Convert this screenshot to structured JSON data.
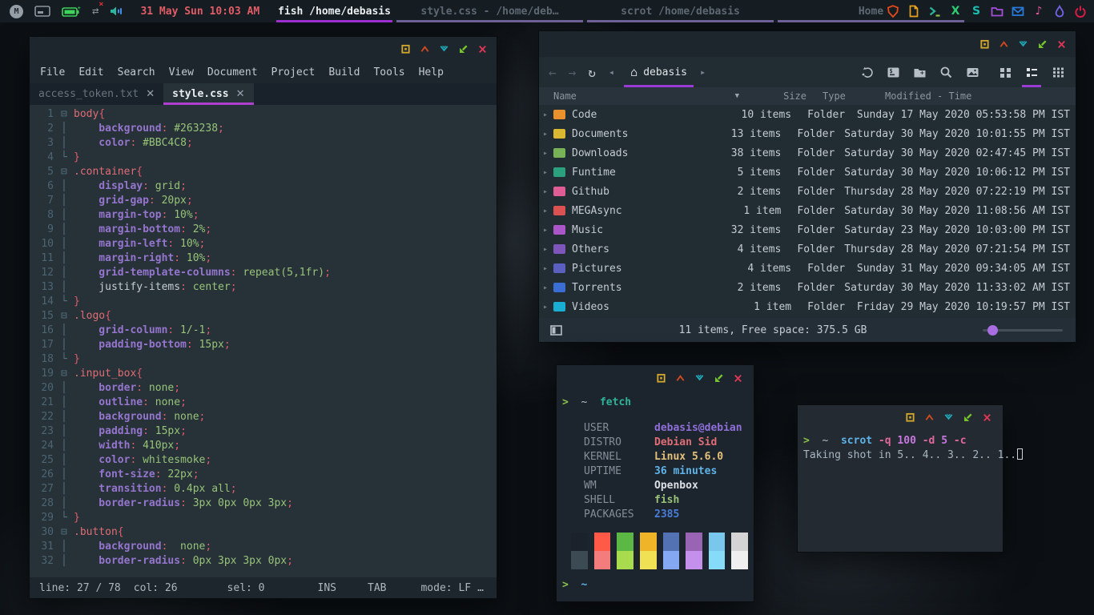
{
  "colors": {
    "accent_purple": "#9b2fd0",
    "tab_magenta": "#b03fd0",
    "clock_red": "#e05c66",
    "editor_bg": "#263238",
    "terminal_bg": "#1c252d"
  },
  "window_buttons": [
    "omni",
    "shade",
    "iconify",
    "maximize",
    "close"
  ],
  "panel": {
    "clock": "31 May Sun 10:03 AM",
    "status_icons": [
      "mega-icon",
      "pager-icon",
      "battery-charging-icon",
      "network-disconnected-icon",
      "volume-icon"
    ],
    "tasks": [
      {
        "label": "fish /home/debasis",
        "active": true
      },
      {
        "label": "style.css - /home/deb…",
        "active": false
      },
      {
        "label": "scrot /home/debasis",
        "active": false
      },
      {
        "label": "Home",
        "active": false
      }
    ],
    "tray_icons": [
      "shield-icon",
      "document-icon",
      "terminal-icon",
      "x-app-icon",
      "s-app-icon",
      "folder-icon",
      "mail-icon",
      "music-icon",
      "drop-icon",
      "power-icon"
    ]
  },
  "editor": {
    "menus": [
      "File",
      "Edit",
      "Search",
      "View",
      "Document",
      "Project",
      "Build",
      "Tools",
      "Help"
    ],
    "tabs": [
      {
        "label": "access_token.txt",
        "close": "✕",
        "active": false
      },
      {
        "label": "style.css",
        "close": "✕",
        "active": true
      }
    ],
    "code_lines": [
      {
        "n": "1",
        "f": "o",
        "s": [
          [
            "sel",
            "body"
          ],
          [
            "punc",
            "{"
          ]
        ]
      },
      {
        "n": "2",
        "f": "v",
        "s": [
          [
            "prop",
            "    background"
          ],
          [
            "punc",
            ":"
          ],
          [
            "val",
            " #263238"
          ],
          [
            "punc",
            ";"
          ]
        ]
      },
      {
        "n": "3",
        "f": "v",
        "s": [
          [
            "prop",
            "    color"
          ],
          [
            "punc",
            ":"
          ],
          [
            "val",
            " #BBC4C8"
          ],
          [
            "punc",
            ";"
          ]
        ]
      },
      {
        "n": "4",
        "f": "c",
        "s": [
          [
            "punc",
            "}"
          ]
        ]
      },
      {
        "n": "5",
        "f": "o",
        "s": [
          [
            "sel",
            ".container"
          ],
          [
            "punc",
            "{"
          ]
        ]
      },
      {
        "n": "6",
        "f": "v",
        "s": [
          [
            "prop",
            "    display"
          ],
          [
            "punc",
            ":"
          ],
          [
            "val",
            " grid"
          ],
          [
            "punc",
            ";"
          ]
        ]
      },
      {
        "n": "7",
        "f": "v",
        "s": [
          [
            "prop",
            "    grid-gap"
          ],
          [
            "punc",
            ":"
          ],
          [
            "val",
            " 20px"
          ],
          [
            "punc",
            ";"
          ]
        ]
      },
      {
        "n": "8",
        "f": "v",
        "s": [
          [
            "prop",
            "    margin-top"
          ],
          [
            "punc",
            ":"
          ],
          [
            "val",
            " 10%"
          ],
          [
            "punc",
            ";"
          ]
        ]
      },
      {
        "n": "9",
        "f": "v",
        "s": [
          [
            "prop",
            "    margin-bottom"
          ],
          [
            "punc",
            ":"
          ],
          [
            "val",
            " 2%"
          ],
          [
            "punc",
            ";"
          ]
        ]
      },
      {
        "n": "10",
        "f": "v",
        "s": [
          [
            "prop",
            "    margin-left"
          ],
          [
            "punc",
            ":"
          ],
          [
            "val",
            " 10%"
          ],
          [
            "punc",
            ";"
          ]
        ]
      },
      {
        "n": "11",
        "f": "v",
        "s": [
          [
            "prop",
            "    margin-right"
          ],
          [
            "punc",
            ":"
          ],
          [
            "val",
            " 10%"
          ],
          [
            "punc",
            ";"
          ]
        ]
      },
      {
        "n": "12",
        "f": "v",
        "s": [
          [
            "prop",
            "    grid-template-columns"
          ],
          [
            "punc",
            ":"
          ],
          [
            "val",
            " repeat(5,1fr)"
          ],
          [
            "punc",
            ";"
          ]
        ]
      },
      {
        "n": "13",
        "f": "v",
        "s": [
          [
            "plain",
            "    justify-items"
          ],
          [
            "punc",
            ":"
          ],
          [
            "val",
            " center"
          ],
          [
            "punc",
            ";"
          ]
        ]
      },
      {
        "n": "14",
        "f": "c",
        "s": [
          [
            "punc",
            "}"
          ]
        ]
      },
      {
        "n": "15",
        "f": "o",
        "s": [
          [
            "sel",
            ".logo"
          ],
          [
            "punc",
            "{"
          ]
        ]
      },
      {
        "n": "16",
        "f": "v",
        "s": [
          [
            "prop",
            "    grid-column"
          ],
          [
            "punc",
            ":"
          ],
          [
            "val",
            " 1/-1"
          ],
          [
            "punc",
            ";"
          ]
        ]
      },
      {
        "n": "17",
        "f": "v",
        "s": [
          [
            "prop",
            "    padding-bottom"
          ],
          [
            "punc",
            ":"
          ],
          [
            "val",
            " 15px"
          ],
          [
            "punc",
            ";"
          ]
        ]
      },
      {
        "n": "18",
        "f": "c",
        "s": [
          [
            "punc",
            "}"
          ]
        ]
      },
      {
        "n": "19",
        "f": "o",
        "s": [
          [
            "sel",
            ".input_box"
          ],
          [
            "punc",
            "{"
          ]
        ]
      },
      {
        "n": "20",
        "f": "v",
        "s": [
          [
            "prop",
            "    border"
          ],
          [
            "punc",
            ":"
          ],
          [
            "val",
            " none"
          ],
          [
            "punc",
            ";"
          ]
        ]
      },
      {
        "n": "21",
        "f": "v",
        "s": [
          [
            "prop",
            "    outline"
          ],
          [
            "punc",
            ":"
          ],
          [
            "val",
            " none"
          ],
          [
            "punc",
            ";"
          ]
        ]
      },
      {
        "n": "22",
        "f": "v",
        "s": [
          [
            "prop",
            "    background"
          ],
          [
            "punc",
            ":"
          ],
          [
            "val",
            " none"
          ],
          [
            "punc",
            ";"
          ]
        ]
      },
      {
        "n": "23",
        "f": "v",
        "s": [
          [
            "prop",
            "    padding"
          ],
          [
            "punc",
            ":"
          ],
          [
            "val",
            " 15px"
          ],
          [
            "punc",
            ";"
          ]
        ]
      },
      {
        "n": "24",
        "f": "v",
        "s": [
          [
            "prop",
            "    width"
          ],
          [
            "punc",
            ":"
          ],
          [
            "val",
            " 410px"
          ],
          [
            "punc",
            ";"
          ]
        ]
      },
      {
        "n": "25",
        "f": "v",
        "s": [
          [
            "prop",
            "    color"
          ],
          [
            "punc",
            ":"
          ],
          [
            "val",
            " whitesmoke"
          ],
          [
            "punc",
            ";"
          ]
        ]
      },
      {
        "n": "26",
        "f": "v",
        "s": [
          [
            "prop",
            "    font-size"
          ],
          [
            "punc",
            ":"
          ],
          [
            "val",
            " 22px"
          ],
          [
            "punc",
            ";"
          ]
        ]
      },
      {
        "n": "27",
        "f": "v",
        "s": [
          [
            "prop",
            "    transition"
          ],
          [
            "punc",
            ":"
          ],
          [
            "val",
            " 0.4px all"
          ],
          [
            "punc",
            ";"
          ]
        ]
      },
      {
        "n": "28",
        "f": "v",
        "s": [
          [
            "prop",
            "    border-radius"
          ],
          [
            "punc",
            ":"
          ],
          [
            "val",
            " 3px 0px 0px 3px"
          ],
          [
            "punc",
            ";"
          ]
        ]
      },
      {
        "n": "29",
        "f": "c",
        "s": [
          [
            "punc",
            "}"
          ]
        ]
      },
      {
        "n": "30",
        "f": "o",
        "s": [
          [
            "sel",
            ".button"
          ],
          [
            "punc",
            "{"
          ]
        ]
      },
      {
        "n": "31",
        "f": "v",
        "s": [
          [
            "prop",
            "    background"
          ],
          [
            "punc",
            ":"
          ],
          [
            "val",
            "  none"
          ],
          [
            "punc",
            ";"
          ]
        ]
      },
      {
        "n": "32",
        "f": "v",
        "s": [
          [
            "prop",
            "    border-radius"
          ],
          [
            "punc",
            ":"
          ],
          [
            "val",
            " 0px 3px 3px 0px"
          ],
          [
            "punc",
            ";"
          ]
        ]
      }
    ],
    "status": {
      "line": "line: 27 / 78",
      "col": "col: 26",
      "sel": "sel: 0",
      "ins": "INS",
      "tab": "TAB",
      "mode": "mode: LF",
      "more": "…"
    }
  },
  "filemanager": {
    "location": "debasis",
    "columns": [
      "Name",
      "Size",
      "Type",
      "Modified - Time"
    ],
    "sort_icon": "▼",
    "toolbar_icons": [
      "back-icon",
      "forward-icon",
      "refresh-icon",
      "prev-tab-icon",
      "home-icon",
      "next-tab-icon",
      "swap-panes-icon",
      "open-terminal-icon",
      "new-folder-icon",
      "search-icon",
      "wallpaper-icon",
      "icon-view-icon",
      "list-view-icon",
      "compact-view-icon"
    ],
    "rows": [
      {
        "name": "Code",
        "color": "#e8912d",
        "size": "10 items",
        "type": "Folder",
        "modified": "Sunday 17 May 2020 05:53:58 PM IST"
      },
      {
        "name": "Documents",
        "color": "#d9b832",
        "size": "13 items",
        "type": "Folder",
        "modified": "Saturday 30 May 2020 10:01:55 PM IST"
      },
      {
        "name": "Downloads",
        "color": "#77b356",
        "size": "38 items",
        "type": "Folder",
        "modified": "Saturday 30 May 2020 02:47:45 PM IST"
      },
      {
        "name": "Funtime",
        "color": "#2aa17c",
        "size": "5 items",
        "type": "Folder",
        "modified": "Saturday 30 May 2020 10:06:12 PM IST"
      },
      {
        "name": "Github",
        "color": "#e05c94",
        "size": "2 items",
        "type": "Folder",
        "modified": "Thursday 28 May 2020 07:22:19 PM IST"
      },
      {
        "name": "MEGAsync",
        "color": "#da5151",
        "size": "1 item",
        "type": "Folder",
        "modified": "Saturday 30 May 2020 11:08:56 AM IST"
      },
      {
        "name": "Music",
        "color": "#aa55c8",
        "size": "32 items",
        "type": "Folder",
        "modified": "Saturday 23 May 2020 10:03:00 PM IST"
      },
      {
        "name": "Others",
        "color": "#7e55ba",
        "size": "4 items",
        "type": "Folder",
        "modified": "Thursday 28 May 2020 07:21:54 PM IST"
      },
      {
        "name": "Pictures",
        "color": "#5a5fc0",
        "size": "4 items",
        "type": "Folder",
        "modified": "Sunday 31 May 2020 09:34:05 AM IST"
      },
      {
        "name": "Torrents",
        "color": "#3a6ed2",
        "size": "2 items",
        "type": "Folder",
        "modified": "Saturday 30 May 2020 11:33:02 AM IST"
      },
      {
        "name": "Videos",
        "color": "#19aed2",
        "size": "1 item",
        "type": "Folder",
        "modified": "Friday 29 May 2020 10:19:57 PM IST"
      }
    ],
    "status_text": "11 items, Free space: 375.5 GB"
  },
  "fetch_terminal": {
    "prompt1": [
      [
        "g",
        ">"
      ],
      [
        "w",
        "  ~"
      ],
      [
        "t",
        "  fetch"
      ]
    ],
    "info": [
      {
        "label": "USER",
        "value": "debasis@debian",
        "color": "#8f6fd8"
      },
      {
        "label": "DISTRO",
        "value": "Debian Sid",
        "color": "#e06c75"
      },
      {
        "label": "KERNEL",
        "value": "Linux 5.6.0",
        "color": "#e5c07b"
      },
      {
        "label": "UPTIME",
        "value": "36 minutes",
        "color": "#5fb3e8"
      },
      {
        "label": "WM",
        "value": "Openbox",
        "color": "#dcdfe4"
      },
      {
        "label": "SHELL",
        "value": "fish",
        "color": "#98c379"
      },
      {
        "label": "PACKAGES",
        "value": "2385",
        "color": "#4a7ed9"
      }
    ],
    "palette": {
      "top": [
        "#1b222b",
        "#ff5a47",
        "#5cb844",
        "#f0b429",
        "#5272b4",
        "#9a64b4",
        "#79c7ec",
        "#d4d4d4"
      ],
      "bottom": [
        "#3c4a54",
        "#f47c7c",
        "#a8dc4e",
        "#f0e054",
        "#84a9f2",
        "#c490ec",
        "#86dcf8",
        "#efefef"
      ]
    },
    "prompt2": [
      [
        "g",
        ">"
      ],
      [
        "bl",
        "  ~"
      ]
    ]
  },
  "scrot_terminal": {
    "command": [
      [
        "g",
        ">"
      ],
      [
        "w",
        "  ~"
      ],
      [
        "b",
        "  scrot"
      ],
      [
        "p",
        " -q"
      ],
      [
        "m",
        " 100"
      ],
      [
        "p",
        " -d"
      ],
      [
        "m",
        " 5"
      ],
      [
        "p",
        " -c"
      ]
    ],
    "output": "Taking shot in 5.. 4.. 3.. 2.. 1.."
  }
}
